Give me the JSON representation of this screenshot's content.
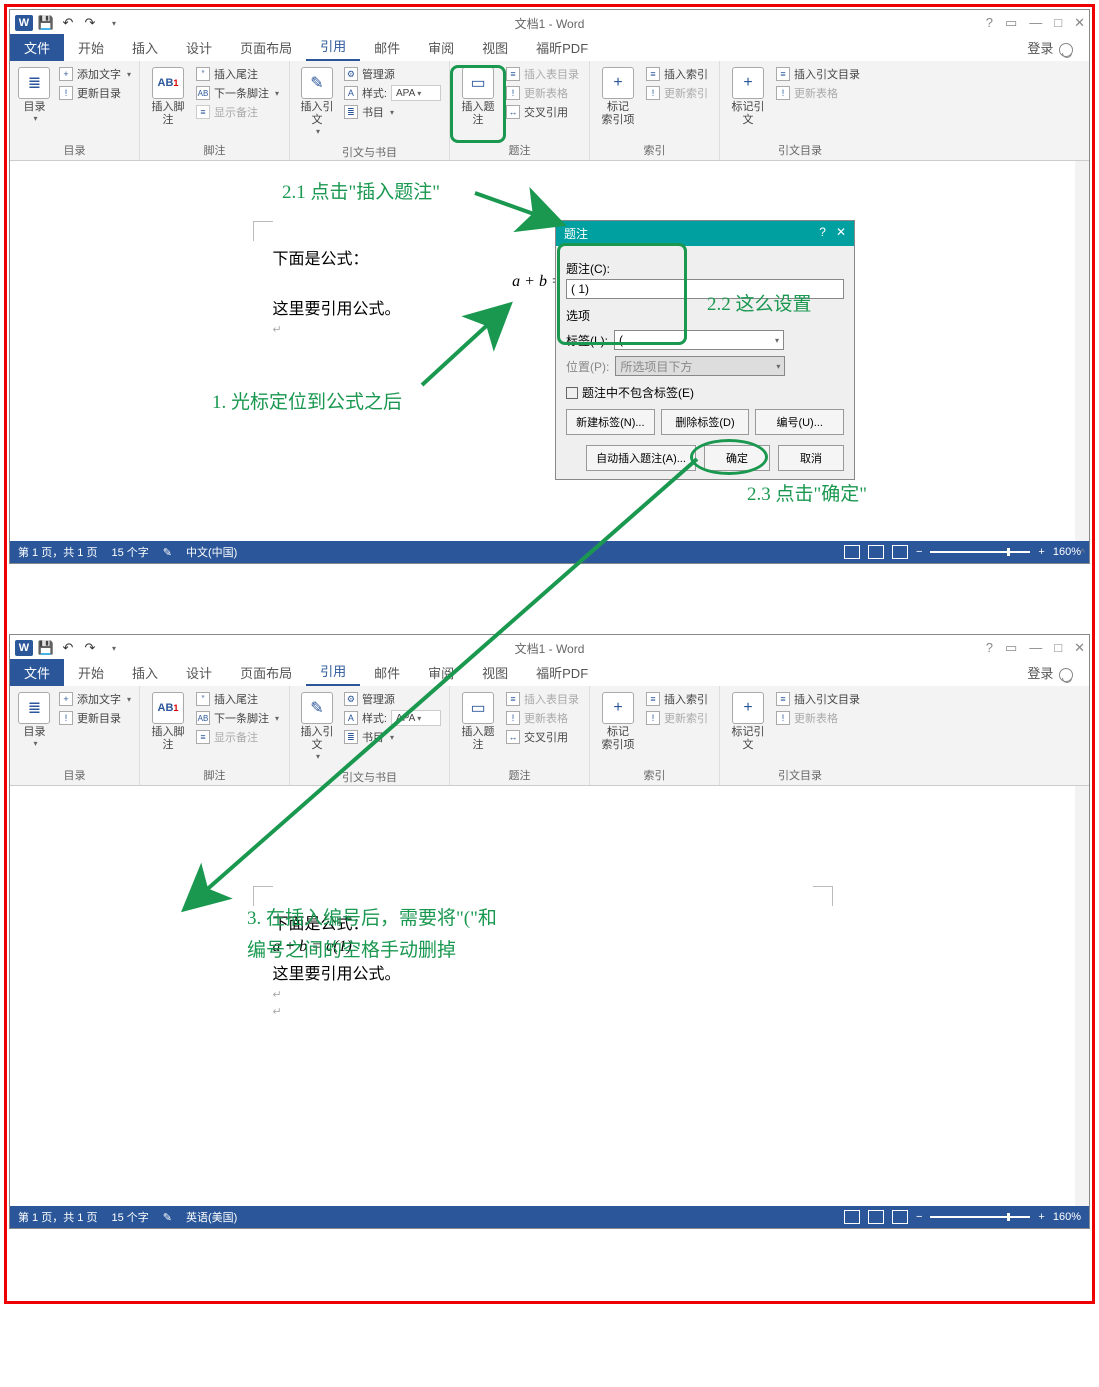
{
  "title": "文档1 - Word",
  "tabs": {
    "file": "文件",
    "home": "开始",
    "insert": "插入",
    "design": "设计",
    "layout": "页面布局",
    "references": "引用",
    "mailings": "邮件",
    "review": "审阅",
    "view": "视图",
    "foxit": "福昕PDF"
  },
  "login": "登录",
  "ribbon": {
    "toc": {
      "big": "目录",
      "addText": "添加文字",
      "update": "更新目录",
      "group": "目录"
    },
    "footnote": {
      "big": "插入脚注",
      "endnote": "插入尾注",
      "next": "下一条脚注",
      "show": "显示备注",
      "group": "脚注",
      "ab": "AB",
      "one": "1"
    },
    "citation": {
      "big": "插入引文",
      "manage": "管理源",
      "style": "样式:",
      "styleVal": "APA",
      "biblio": "书目",
      "group": "引文与书目"
    },
    "caption": {
      "big": "插入题注",
      "listFig": "插入表目录",
      "updateTbl": "更新表格",
      "crossref": "交叉引用",
      "group": "题注"
    },
    "index": {
      "mark": "标记\n索引项",
      "insertIdx": "插入索引",
      "updateIdx": "更新索引",
      "group": "索引"
    },
    "toa": {
      "mark": "标记引文",
      "insert": "插入引文目录",
      "update": "更新表格",
      "group": "引文目录"
    }
  },
  "doc": {
    "line1": "下面是公式：",
    "formula1": "a + b = c",
    "line2": "这里要引用公式。",
    "formula2": "a + b = c(1)"
  },
  "dialog": {
    "title": "题注",
    "captionLbl": "题注(C):",
    "captionVal": "( 1)",
    "options": "选项",
    "labelLbl": "标签(L):",
    "labelVal": "(",
    "posLbl": "位置(P):",
    "posVal": "所选项目下方",
    "exclude": "题注中不包含标签(E)",
    "newLabel": "新建标签(N)...",
    "delLabel": "删除标签(D)",
    "numbering": "编号(U)...",
    "autoCaption": "自动插入题注(A)...",
    "ok": "确定",
    "cancel": "取消"
  },
  "status": {
    "page": "第 1 页，共 1 页",
    "words": "15 个字",
    "lang1": "中文(中国)",
    "lang2": "英语(美国)",
    "zoom": "160%"
  },
  "anno": {
    "a1": "1. 光标定位到公式之后",
    "a21": "2.1 点击\"插入题注\"",
    "a22": "2.2 这么设置",
    "a23": "2.3 点击\"确定\"",
    "a3a": "3. 在插入编号后，需要将\"(\"和",
    "a3b": "编号之间的空格手动删掉"
  }
}
